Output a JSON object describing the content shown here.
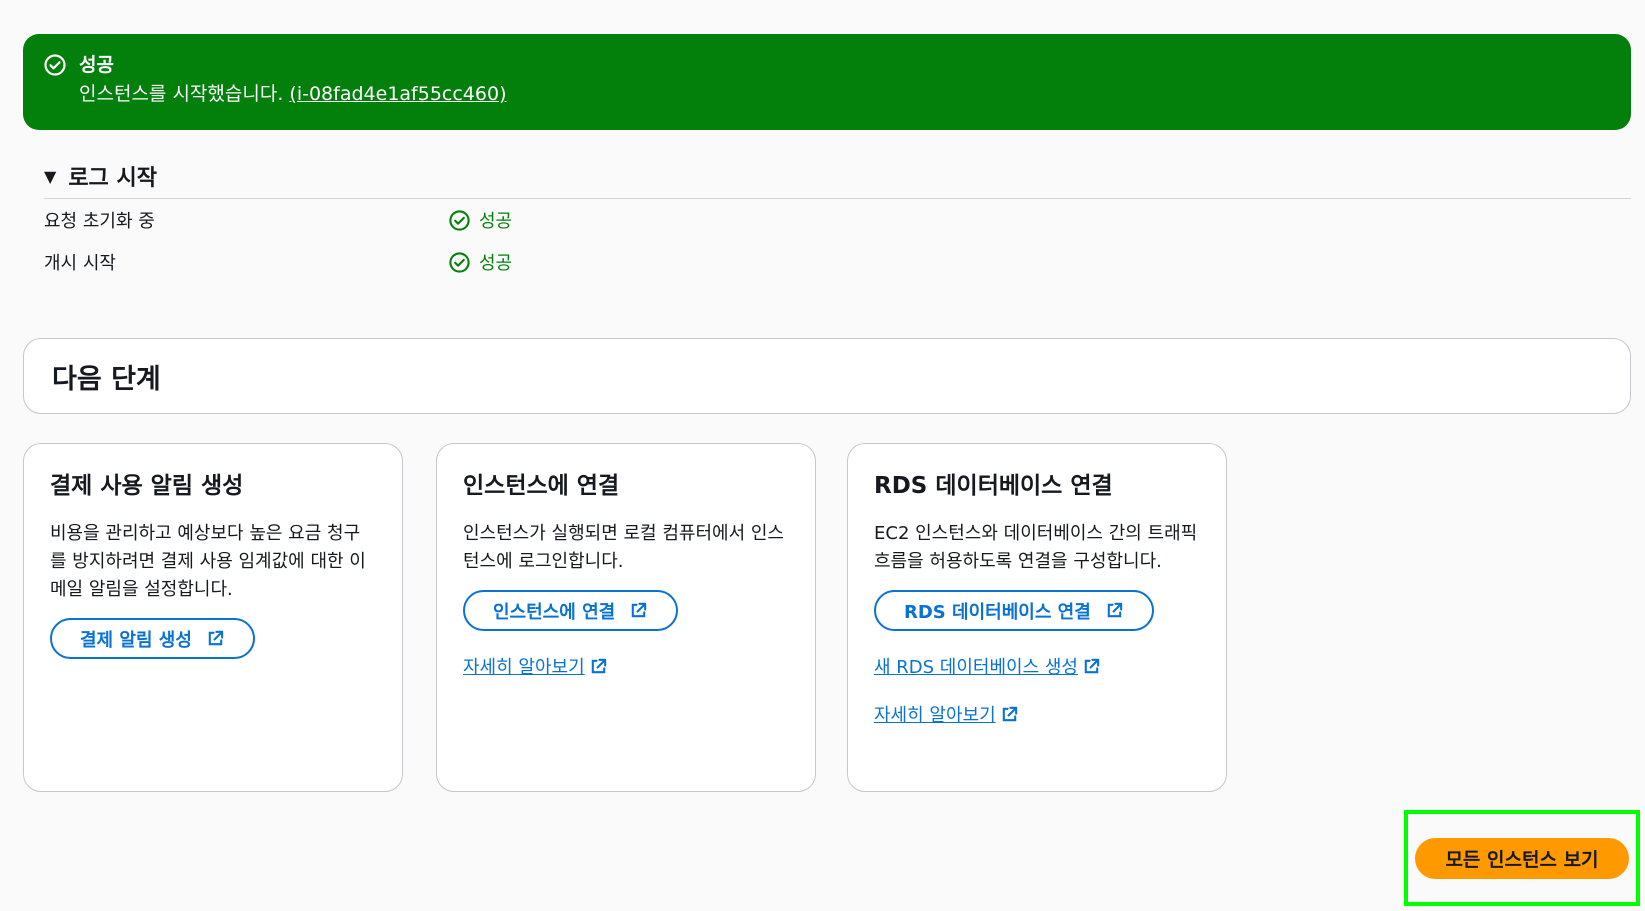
{
  "flash": {
    "title": "성공",
    "message": "인스턴스를 시작했습니다.",
    "instance_link": "(i-08fad4e1af55cc460)"
  },
  "log": {
    "header": "로그 시작",
    "rows": [
      {
        "label": "요청 초기화 중",
        "status": "성공"
      },
      {
        "label": "개시 시작",
        "status": "성공"
      }
    ]
  },
  "next_steps": {
    "title": "다음 단계"
  },
  "cards": [
    {
      "title": "결제 사용 알림 생성",
      "description": "비용을 관리하고 예상보다 높은 요금 청구를 방지하려면 결제 사용 임계값에 대한 이메일 알림을 설정합니다.",
      "button": "결제 알림 생성"
    },
    {
      "title": "인스턴스에 연결",
      "description": "인스턴스가 실행되면 로컬 컴퓨터에서 인스턴스에 로그인합니다.",
      "button": "인스턴스에 연결",
      "links": [
        "자세히 알아보기"
      ]
    },
    {
      "title": "RDS 데이터베이스 연결",
      "description": "EC2 인스턴스와 데이터베이스 간의 트래픽 흐름을 허용하도록 연결을 구성합니다.",
      "button": "RDS 데이터베이스 연결",
      "links": [
        "새 RDS 데이터베이스 생성",
        "자세히 알아보기"
      ]
    }
  ],
  "footer": {
    "view_all_button": "모든 인스턴스 보기"
  },
  "colors": {
    "success": "#037f0c",
    "link": "#0972d3",
    "primary": "#ff9900"
  }
}
